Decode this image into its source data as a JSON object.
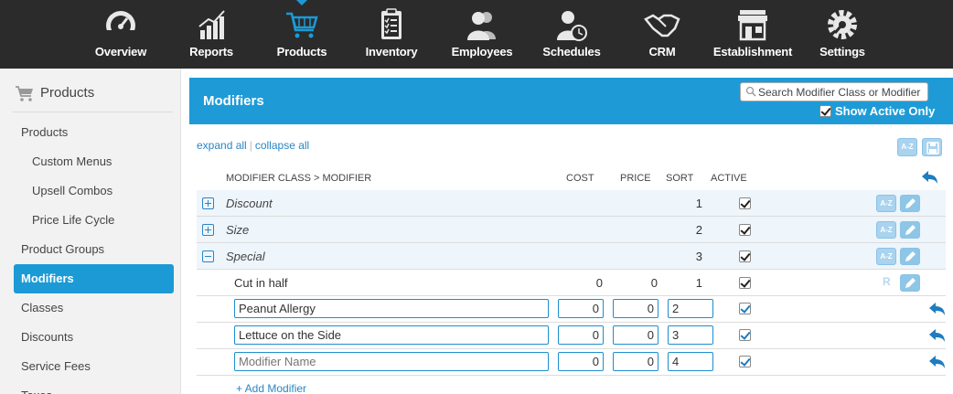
{
  "nav": {
    "items": [
      {
        "label": "Overview",
        "icon": "speedometer-icon"
      },
      {
        "label": "Reports",
        "icon": "bar-chart-icon"
      },
      {
        "label": "Products",
        "icon": "shopping-cart-icon"
      },
      {
        "label": "Inventory",
        "icon": "clipboard-checklist-icon"
      },
      {
        "label": "Employees",
        "icon": "people-icon"
      },
      {
        "label": "Schedules",
        "icon": "person-clock-icon"
      },
      {
        "label": "CRM",
        "icon": "handshake-icon"
      },
      {
        "label": "Establishment",
        "icon": "storefront-icon"
      },
      {
        "label": "Settings",
        "icon": "gear-icon"
      }
    ],
    "active": "Products",
    "accent": "#1b9ad6"
  },
  "sidebar": {
    "header": "Products",
    "items": [
      {
        "label": "Products"
      },
      {
        "label": "Custom Menus"
      },
      {
        "label": "Upsell Combos"
      },
      {
        "label": "Price Life Cycle"
      },
      {
        "label": "Product Groups"
      },
      {
        "label": "Modifiers"
      },
      {
        "label": "Classes"
      },
      {
        "label": "Discounts"
      },
      {
        "label": "Service Fees"
      },
      {
        "label": "Taxes"
      }
    ],
    "active": "Modifiers"
  },
  "panel": {
    "title": "Modifiers",
    "search_placeholder": "Search Modifier Class or Modifier",
    "show_active_label": "Show Active Only",
    "expand_all": "expand all",
    "sep": "|",
    "collapse_all": "collapse all",
    "az_label": "A-Z",
    "r_label": "R",
    "headers": {
      "class_modifier": "MODIFIER CLASS > MODIFIER",
      "cost": "COST",
      "price": "PRICE",
      "sort": "SORT",
      "active": "ACTIVE"
    },
    "groups": [
      {
        "name": "Discount",
        "sort": "1",
        "expanded": false
      },
      {
        "name": "Size",
        "sort": "2",
        "expanded": false
      },
      {
        "name": "Special",
        "sort": "3",
        "expanded": true
      }
    ],
    "modifier": {
      "name": "Cut in half",
      "cost": "0",
      "price": "0",
      "sort": "1"
    },
    "edit_rows": [
      {
        "name": "Peanut Allergy",
        "cost": "0",
        "price": "0",
        "sort": "2"
      },
      {
        "name": "Lettuce on the Side",
        "cost": "0",
        "price": "0",
        "sort": "3"
      },
      {
        "name": "",
        "placeholder": "Modifier Name",
        "cost": "0",
        "price": "0",
        "sort": "4"
      }
    ],
    "add_modifier": "+ Add Modifier"
  }
}
